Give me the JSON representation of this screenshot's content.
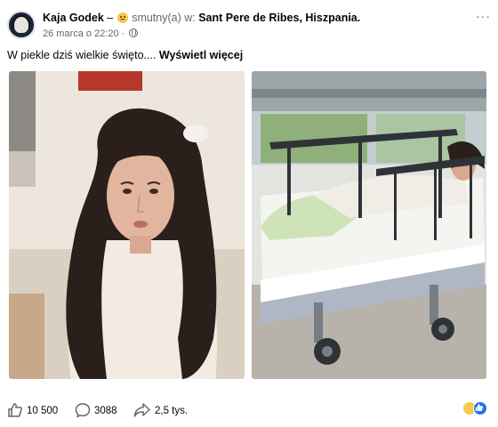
{
  "post": {
    "author": "Kaja Godek",
    "separator": "–",
    "feeling_text": "smutny(a) w:",
    "location": "Sant Pere de Ribes, Hiszpania.",
    "date": "26 marca o 22:20 ·",
    "text": "W piekle dziś wielkie święto....",
    "see_more": "Wyświetl więcej",
    "menu": "···"
  },
  "stats": {
    "likes": "10 500",
    "comments": "3088",
    "shares": "2,5 tys."
  },
  "icons": {
    "audience": "globe-icon",
    "like": "thumbs-up-icon",
    "comment": "comment-bubble-icon",
    "share": "share-arrow-icon",
    "reactions": [
      "sad-reaction-icon",
      "like-reaction-icon"
    ]
  },
  "colors": {
    "secondary_text": "#65676b",
    "like_blue": "#1877f2",
    "emoji_yellow": "#f7c948"
  }
}
